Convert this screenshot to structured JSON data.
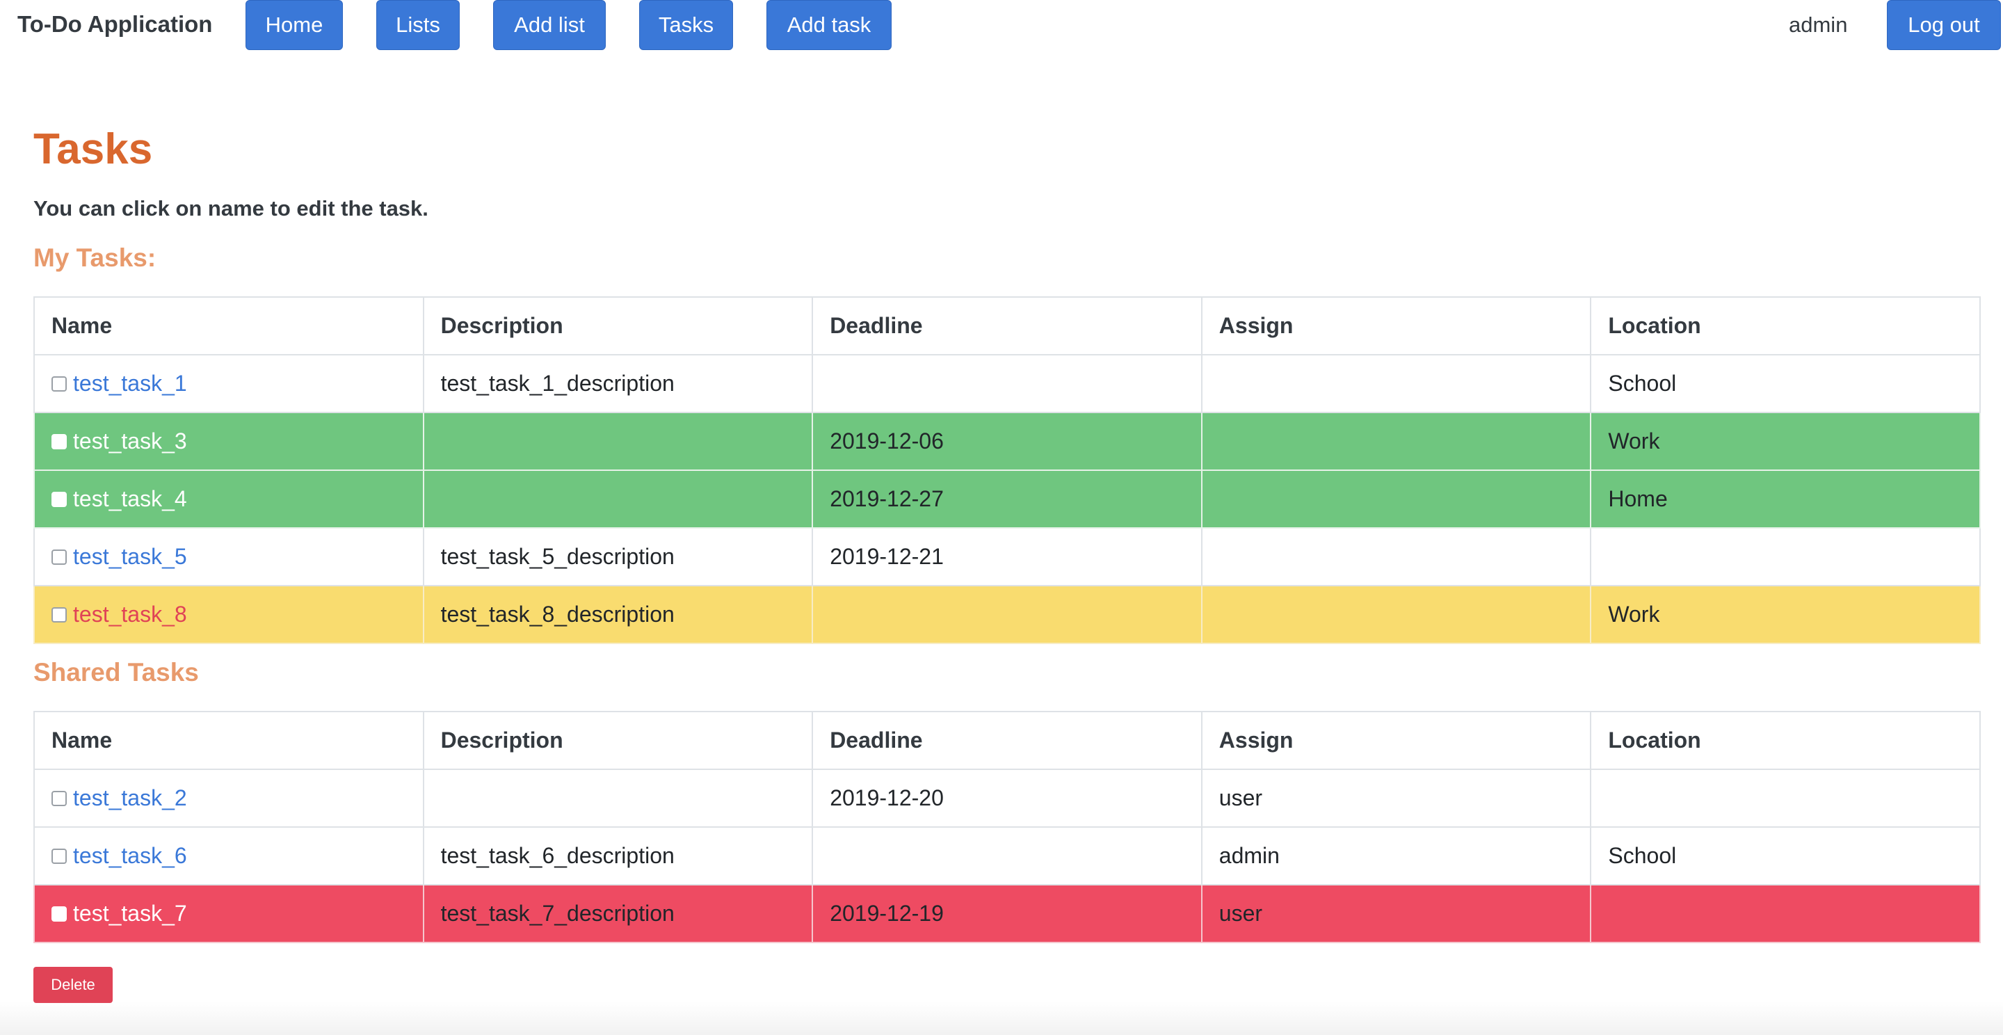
{
  "navbar": {
    "brand": "To-Do Application",
    "buttons": [
      "Home",
      "Lists",
      "Add list",
      "Tasks",
      "Add task"
    ],
    "user": "admin",
    "logout": "Log out"
  },
  "page": {
    "title": "Tasks",
    "hint": "You can click on name to edit the task.",
    "my_tasks_title": "My Tasks:",
    "shared_tasks_title": "Shared Tasks",
    "delete_label": "Delete"
  },
  "columns": [
    "Name",
    "Description",
    "Deadline",
    "Assign",
    "Location"
  ],
  "my_tasks": [
    {
      "name": "test_task_1",
      "description": "test_task_1_description",
      "deadline": "",
      "assign": "",
      "location": "School",
      "status": "normal"
    },
    {
      "name": "test_task_3",
      "description": "",
      "deadline": "2019-12-06",
      "assign": "",
      "location": "Work",
      "status": "green"
    },
    {
      "name": "test_task_4",
      "description": "",
      "deadline": "2019-12-27",
      "assign": "",
      "location": "Home",
      "status": "green"
    },
    {
      "name": "test_task_5",
      "description": "test_task_5_description",
      "deadline": "2019-12-21",
      "assign": "",
      "location": "",
      "status": "normal"
    },
    {
      "name": "test_task_8",
      "description": "test_task_8_description",
      "deadline": "",
      "assign": "",
      "location": "Work",
      "status": "yellow"
    }
  ],
  "shared_tasks": [
    {
      "name": "test_task_2",
      "description": "",
      "deadline": "2019-12-20",
      "assign": "user",
      "location": "",
      "status": "normal"
    },
    {
      "name": "test_task_6",
      "description": "test_task_6_description",
      "deadline": "",
      "assign": "admin",
      "location": "School",
      "status": "normal"
    },
    {
      "name": "test_task_7",
      "description": "test_task_7_description",
      "deadline": "2019-12-19",
      "assign": "user",
      "location": "",
      "status": "red"
    }
  ],
  "colors": {
    "primary": "#3a78d8",
    "title": "#d9672e",
    "section_title": "#e89a6c",
    "green_row": "#6fc67f",
    "yellow_row": "#f9dc6f",
    "red_row": "#ee4b62",
    "danger": "#e04356"
  }
}
